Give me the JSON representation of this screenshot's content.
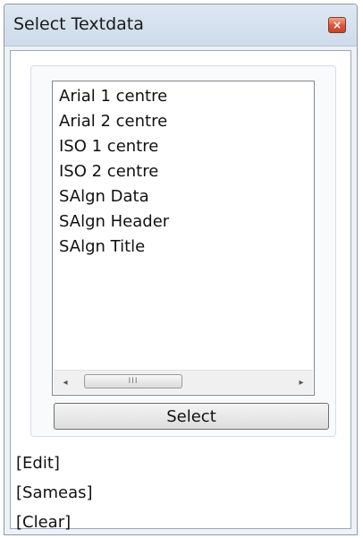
{
  "window": {
    "title": "Select Textdata",
    "close_symbol": "×"
  },
  "list": {
    "items": [
      "Arial 1 centre",
      "Arial 2 centre",
      "ISO 1 centre",
      "ISO 2 centre",
      "SAlgn Data",
      "SAlgn Header",
      "SAlgn Title"
    ],
    "scroll_left_icon": "◂",
    "scroll_thumb_grip": "III",
    "scroll_right_icon": "▸"
  },
  "buttons": {
    "select_label": "Select"
  },
  "actions": {
    "edit": "[Edit]",
    "sameas": "[Sameas]",
    "clear": "[Clear]"
  }
}
